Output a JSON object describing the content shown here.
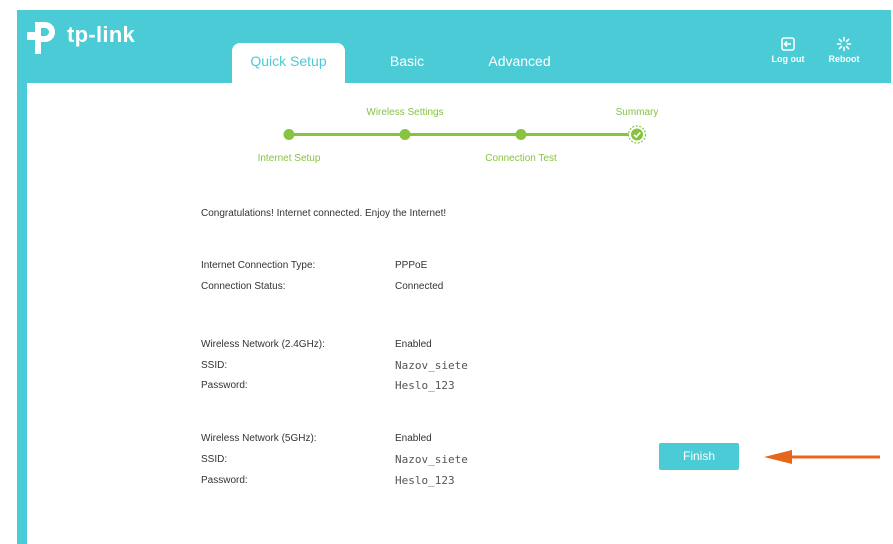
{
  "brand": {
    "name": "tp-link"
  },
  "tabs": [
    {
      "label": "Quick Setup",
      "active": true
    },
    {
      "label": "Basic",
      "active": false
    },
    {
      "label": "Advanced",
      "active": false
    }
  ],
  "header_actions": {
    "logout": {
      "label": "Log out",
      "icon": "logout-icon"
    },
    "reboot": {
      "label": "Reboot",
      "icon": "reboot-icon"
    }
  },
  "progress_steps": [
    {
      "label": "Internet Setup",
      "status": "done"
    },
    {
      "label": "Wireless Settings",
      "status": "done"
    },
    {
      "label": "Connection Test",
      "status": "done"
    },
    {
      "label": "Summary",
      "status": "current"
    }
  ],
  "message": "Congratulations! Internet connected. Enjoy the Internet!",
  "connection": {
    "type_label": "Internet Connection Type:",
    "type_value": "PPPoE",
    "status_label": "Connection Status:",
    "status_value": "Connected"
  },
  "wireless_24": {
    "network_label": "Wireless Network (2.4GHz):",
    "network_value": "Enabled",
    "ssid_label": "SSID:",
    "ssid_value": "Nazov_siete",
    "password_label": "Password:",
    "password_value": "Heslo_123"
  },
  "wireless_5": {
    "network_label": "Wireless Network (5GHz):",
    "network_value": "Enabled",
    "ssid_label": "SSID:",
    "ssid_value": "Nazov_siete",
    "password_label": "Password:",
    "password_value": "Heslo_123"
  },
  "finish_button": {
    "label": "Finish"
  },
  "colors": {
    "brand": "#4acbd6",
    "progress": "#86c341",
    "arrow": "#e8661c"
  }
}
